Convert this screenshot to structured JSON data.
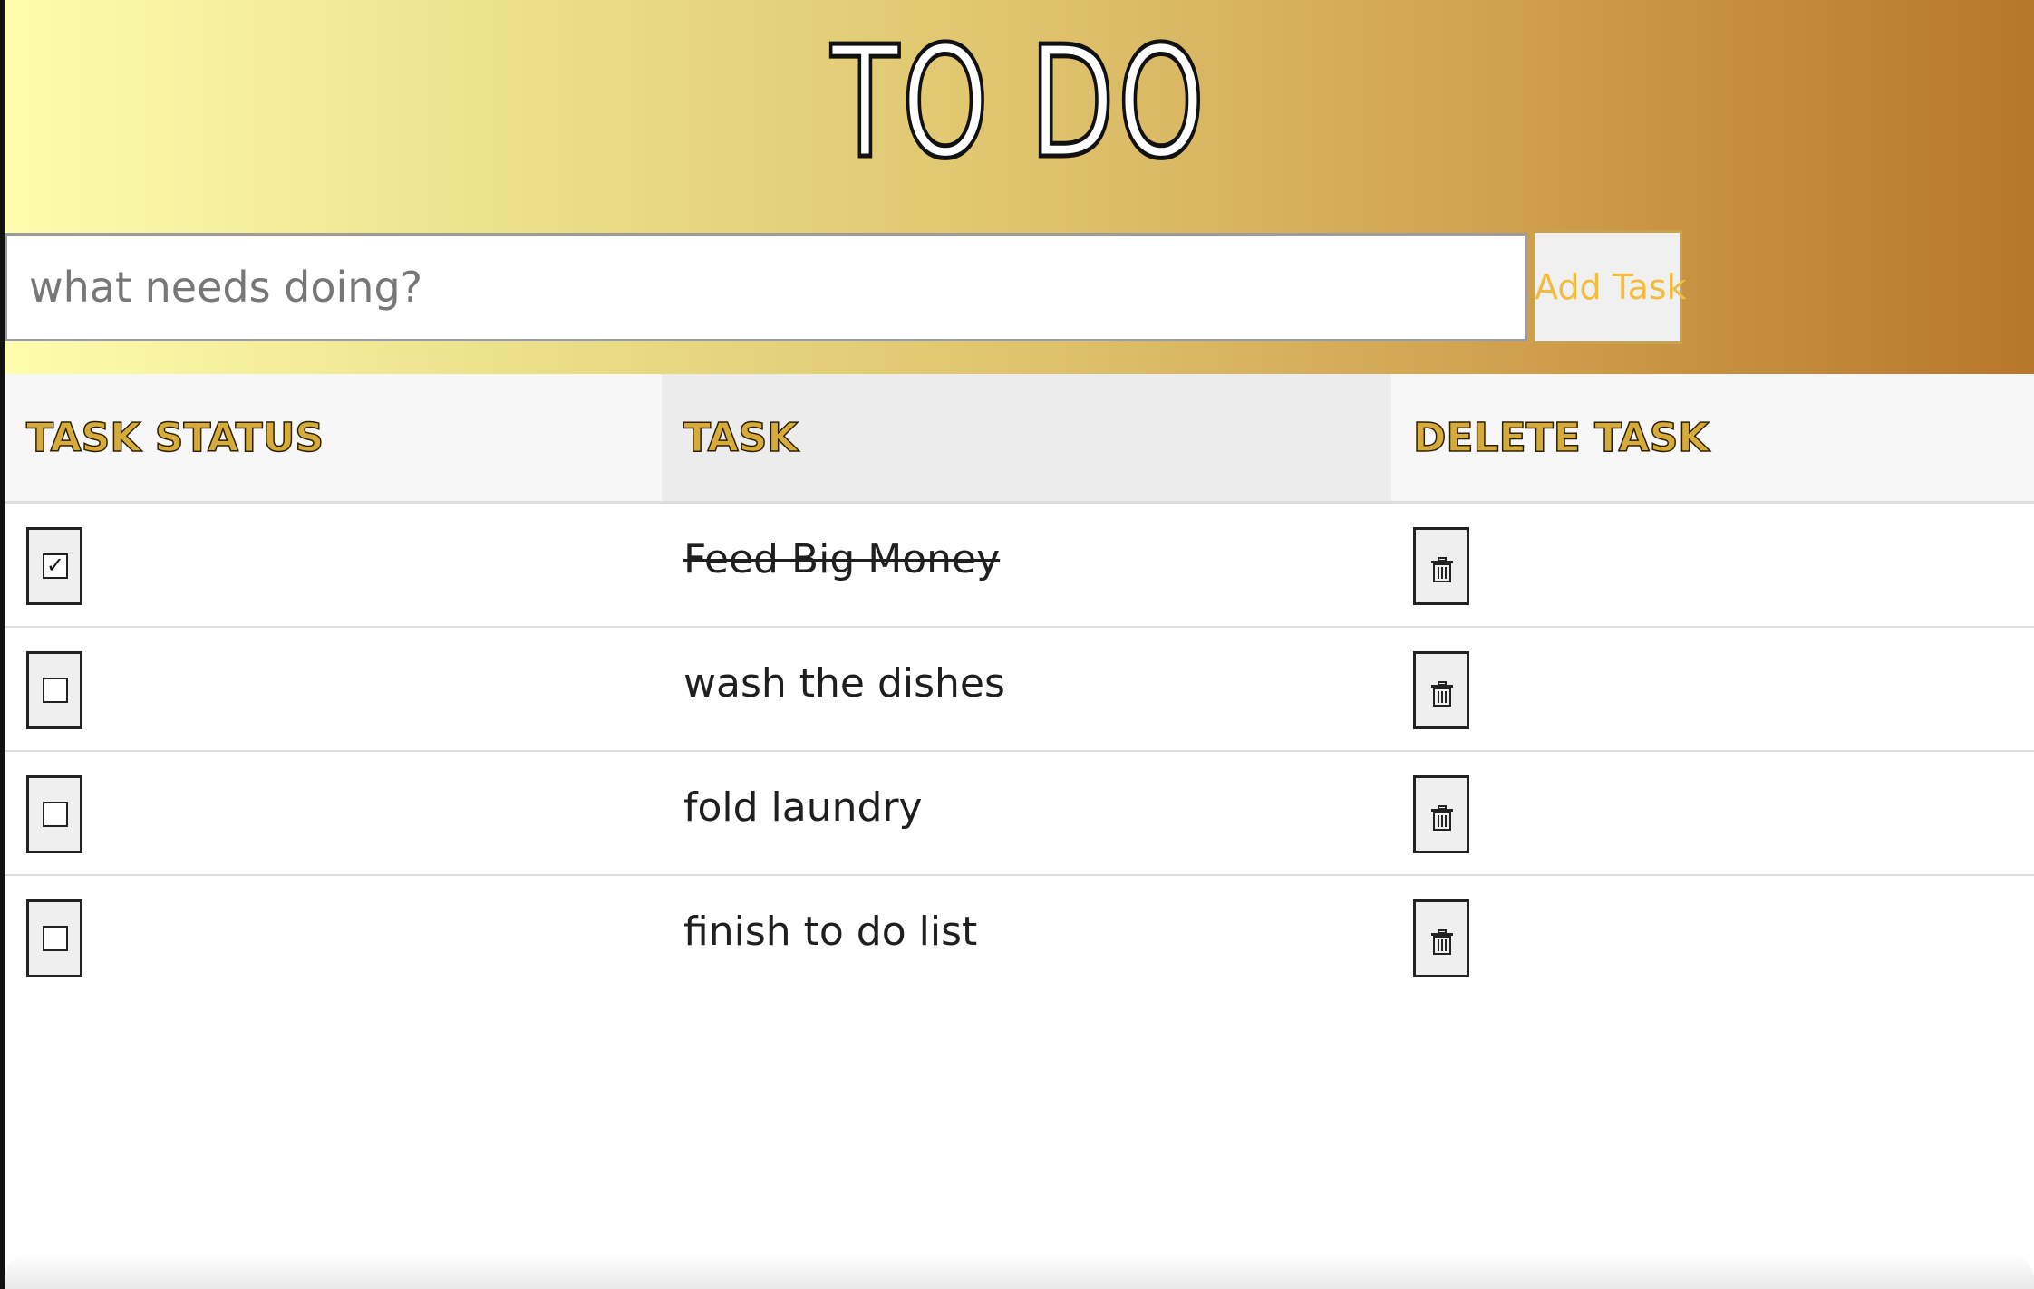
{
  "header": {
    "title": "TO DO"
  },
  "new_task": {
    "placeholder": "what needs doing?",
    "value": "",
    "add_label": "Add Task"
  },
  "table": {
    "headers": {
      "status": "TASK STATUS",
      "task": "TASK",
      "delete": "DELETE TASK"
    },
    "rows": [
      {
        "task": "Feed Big Money",
        "done": true,
        "check_mark": "✓",
        "delete_icon": "trash-icon"
      },
      {
        "task": "wash the dishes",
        "done": false,
        "check_mark": "",
        "delete_icon": "trash-icon"
      },
      {
        "task": "fold laundry",
        "done": false,
        "check_mark": "",
        "delete_icon": "trash-icon"
      },
      {
        "task": "finish to do list",
        "done": false,
        "check_mark": "",
        "delete_icon": "trash-icon"
      }
    ]
  },
  "colors": {
    "gradient_start": "#fdfdae",
    "gradient_end": "#b7772a",
    "header_text": "#d6ab3a",
    "add_button_text": "#f3bc3e"
  }
}
